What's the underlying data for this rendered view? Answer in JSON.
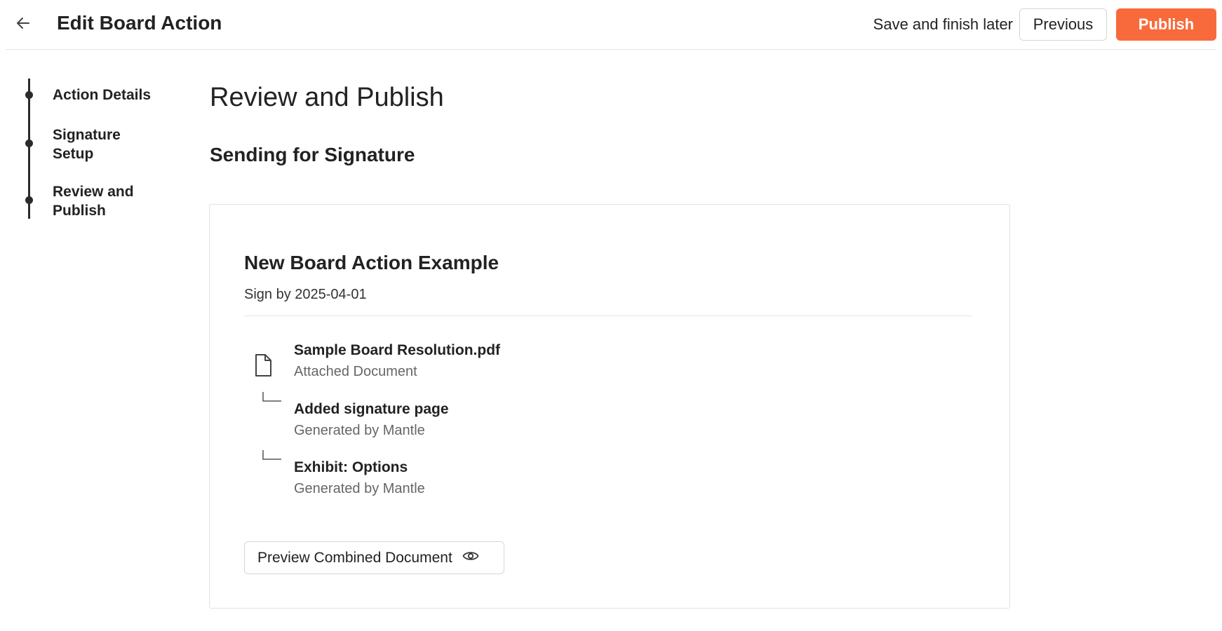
{
  "header": {
    "title": "Edit Board Action",
    "back_icon": "arrow-left-icon",
    "save_later_label": "Save and finish later",
    "previous_label": "Previous",
    "publish_label": "Publish",
    "publish_color": "#f86a3b"
  },
  "stepper": {
    "steps": [
      {
        "label": "Action Details"
      },
      {
        "label": "Signature Setup"
      },
      {
        "label": "Review and Publish"
      }
    ]
  },
  "main": {
    "title": "Review and Publish",
    "section_title": "Sending for Signature",
    "card": {
      "title": "New Board Action Example",
      "sign_by": "Sign by 2025-04-01",
      "items": [
        {
          "name": "Sample Board Resolution.pdf",
          "meta": "Attached Document",
          "icon": "file-icon"
        },
        {
          "name": "Added signature page",
          "meta": "Generated by Mantle",
          "icon": "branch-icon"
        },
        {
          "name": "Exhibit: Options",
          "meta": "Generated by Mantle",
          "icon": "branch-icon"
        }
      ],
      "preview_label": "Preview Combined Document",
      "preview_icon": "eye-icon"
    }
  }
}
